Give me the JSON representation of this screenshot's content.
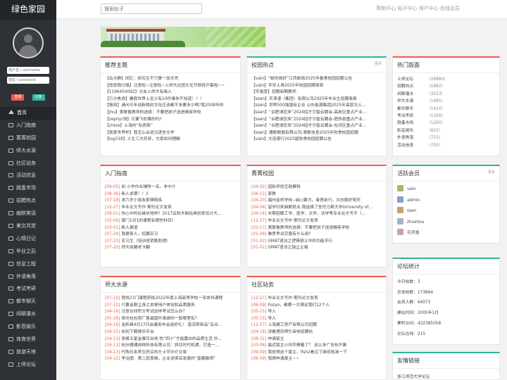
{
  "sidebar": {
    "logo": "绿色家园",
    "username_placeholder": "用户名 / username",
    "password_placeholder": "密码 / password",
    "login_label": "登录",
    "register_label": "注册",
    "nav": [
      {
        "label": "首页",
        "icon": "home-icon"
      },
      {
        "label": "入门指南",
        "icon": "folder-icon"
      },
      {
        "label": "菁菁校园",
        "icon": "folder-icon"
      },
      {
        "label": "师大水源",
        "icon": "folder-icon"
      },
      {
        "label": "社区站务",
        "icon": "folder-icon"
      },
      {
        "label": "活动信息",
        "icon": "folder-icon"
      },
      {
        "label": "跳蚤市场",
        "icon": "folder-icon"
      },
      {
        "label": "招聘热点",
        "icon": "folder-icon"
      },
      {
        "label": "幽默笑话",
        "icon": "folder-icon"
      },
      {
        "label": "美文共赏",
        "icon": "folder-icon"
      },
      {
        "label": "心情日记",
        "icon": "folder-icon"
      },
      {
        "label": "毕业之后",
        "icon": "folder-icon"
      },
      {
        "label": "信息工程",
        "icon": "folder-icon"
      },
      {
        "label": "外语角落",
        "icon": "folder-icon"
      },
      {
        "label": "考试考研",
        "icon": "folder-icon"
      },
      {
        "label": "都市聊天",
        "icon": "folder-icon"
      },
      {
        "label": "闲聊灌水",
        "icon": "folder-icon"
      },
      {
        "label": "影音娱乐",
        "icon": "folder-icon"
      },
      {
        "label": "体育世界",
        "icon": "folder-icon"
      },
      {
        "label": "旅游天地",
        "icon": "folder-icon"
      },
      {
        "label": "上师论坛",
        "icon": "folder-icon"
      }
    ]
  },
  "topbar": {
    "search_placeholder": "搜索帖子",
    "links": "帮助中心  帖子中心  用户中心  在线会员"
  },
  "recommend": {
    "title": "推荐主题",
    "items": [
      "【云点静】回忆：研究生不只是一张文凭",
      "【悠悠我行路】注意啦~注意啦~上师大社团文化节即将开幕啦~~",
      "【1196454092】交友上师大有缘人",
      "【万分焦虑】暑假世界上至少有10件事你不知道！！！",
      "【骆芮】请问今年迎新晚的文化应该都不多要多少啊?我2008年的",
      "【jhu】美联鲁教师的选择：不要把孩子送进精英学校",
      "【zephyr测】又要飞机票的吗?",
      "【chloe】上海的“私房菜”",
      "【我爱世界杯】我怎么会进汉语言文学",
      "【log318】人生三大死穿，大家如何理解"
    ]
  },
  "campus_hot": {
    "title": "校园热点",
    "more": "更多",
    "items": [
      "【vain】“邮你政好”江西邮政2025年春季校园招聘公告",
      "【vain】平安人寿2025年校园招聘简章",
      "【天路宽】招聘新期教师",
      "【ssen】天津港（集团）有限公司2025年毕业生招聘简章",
      "【ssen】世界500强国有企业 山东能源集团2025年高层次人…",
      "【ssen】“合肥请您来”2024招才引智云聘会-高新区重点产业…",
      "【ssen】“合肥请您来”2024招才引智云聘会-肥西县重点产业…",
      "【ssen】“合肥请您来”2024招才引智云聘会-包河区重点产业…",
      "【ssen】德联数据有限公司-寒数信息2025年秋季校园招聘",
      "【vain】大连银行2025届秋季校园招聘公告"
    ]
  },
  "hot_boards": {
    "title": "热门版面",
    "items": [
      {
        "name": "上师论坛",
        "count": "（26880）"
      },
      {
        "name": "招聘热点",
        "count": "（5882）"
      },
      {
        "name": "闲聊灌水",
        "count": "（3153）"
      },
      {
        "name": "师大水源",
        "count": "（1485）"
      },
      {
        "name": "都市聊天",
        "count": "（1410）"
      },
      {
        "name": "考试考研",
        "count": "（1326）"
      },
      {
        "name": "跳蚤市场",
        "count": "（1200）"
      },
      {
        "name": "影音娱乐",
        "count": "（822）"
      },
      {
        "name": "外语角落",
        "count": "（753）"
      },
      {
        "name": "活动信息",
        "count": "（750）"
      }
    ]
  },
  "guide": {
    "title": "入门指南",
    "items": [
      {
        "date": "[09-05]",
        "text": "如 小学作业辅导一名，非中介"
      },
      {
        "date": "[08-26]",
        "text": "新人求罩！！1"
      },
      {
        "date": "[07-18]",
        "text": "求六岁小朋友那辑陪练"
      },
      {
        "date": "[12-27]",
        "text": "毕业论文写作 期刊论文发表"
      },
      {
        "date": "[06-01]",
        "text": "你心中的玩具长啥样？2017云和木制玩具创意设计大…"
      },
      {
        "date": "[05-09]",
        "text": "掌门1对1的课程有哪些科目?"
      },
      {
        "date": "[03-01]",
        "text": "新人报道"
      },
      {
        "date": "[07-24]",
        "text": "我是新人，招募实习"
      },
      {
        "date": "[07-23]",
        "text": "实习生（培训班销售助理）"
      },
      {
        "date": "[07-20]",
        "text": "师大收藏老卡翻"
      }
    ]
  },
  "campus": {
    "title": "菁菁校园",
    "items": [
      {
        "date": "[04-02]",
        "text": "园影师找互助模特"
      },
      {
        "date": "[06-11]",
        "text": "家教"
      },
      {
        "date": "[04-20]",
        "text": "福州金桥学校--诚心聚力，奋勇前行，共创美好明天"
      },
      {
        "date": "[04-08]",
        "text": "留学归来麻薪就业,我选择了圣托马斯大学University of…"
      },
      {
        "date": "[04-14]",
        "text": "长期招聘工学、医学、文学、法学等专业论文写手（…"
      },
      {
        "date": "[12-27]",
        "text": "毕业论文写作 期刊论文发表"
      },
      {
        "date": "[02-17]",
        "text": "美联鲁教师的选择：不要把孩子送进精英学校"
      },
      {
        "date": "[01-08]",
        "text": "雅思考试究竟有什么用?"
      },
      {
        "date": "[01-02]",
        "text": "GMAT语法之逻辑语义中的功能平行"
      },
      {
        "date": "[01-02]",
        "text": "GMAT语法之独立主格"
      }
    ]
  },
  "members": {
    "title": "活跃会员",
    "more": "更多",
    "items": [
      "vain",
      "admin",
      "ssen",
      "zhushou",
      "花灵凰"
    ]
  },
  "water": {
    "title": "师大水源",
    "items": [
      {
        "date": "[07-10]",
        "text": "我校23门课程获批2022年度上海高等学校一流本科课程"
      },
      {
        "date": "[07-10]",
        "text": "只要金服立身之本是用户体验和品质服务"
      },
      {
        "date": "[04-16]",
        "text": "注意在线积分考试这样考试怎么办?"
      },
      {
        "date": "[05-29]",
        "text": "体坊包包剪厂售最国外演谁的一般哪里有?"
      },
      {
        "date": "[04-16]",
        "text": "金和具4月17日会骗发布会选好礼！ 普洱茶新品“云合…"
      },
      {
        "date": "[04-15]",
        "text": "如何下载微乐平台"
      },
      {
        "date": "[04-13]",
        "text": "张裤五星金翼日出地 防“四十”才能震出的品质生活 抄…"
      },
      {
        "date": "[04-13]",
        "text": "杭州德通网络科技有限公司：抓住时代机遇，打造一…"
      },
      {
        "date": "[04-13]",
        "text": "代购日本养生药买的方士可中介交易"
      },
      {
        "date": "[04-12]",
        "text": "李治图：第二层意维，企业逆境深发展的“皇藏脑洞”"
      }
    ]
  },
  "community": {
    "title": "社区站务",
    "items": [
      {
        "date": "[12-27]",
        "text": "毕业论文写作 期刊论文发表"
      },
      {
        "date": "[06-09]",
        "text": "Fozyo，都哪一次满足我们12个人"
      },
      {
        "date": "[05-15]",
        "text": "导入"
      },
      {
        "date": "[05-15]",
        "text": "导入"
      },
      {
        "date": "[12-07]",
        "text": "上海建工房产有限公司招聘"
      },
      {
        "date": "[04-18]",
        "text": "读看理员帮忙审核招聘帖"
      },
      {
        "date": "[08-31]",
        "text": "申请版主"
      },
      {
        "date": "[03-06]",
        "text": "最近版主小吗平睡着了？ 这么多广告帖不删"
      },
      {
        "date": "[09-09]",
        "text": "我觉得这个版主，fish2看见了麻烦批准一下"
      },
      {
        "date": "[06-09]",
        "text": "我想申请版主~~"
      }
    ]
  },
  "stats": {
    "title": "论坛统计",
    "items": [
      "今日帖数：3",
      "总发帖数：173864",
      "会员人数：64073",
      "建站时间：2005年1月",
      "累积访问：432385058",
      "论坛在线：215"
    ]
  },
  "friends": {
    "title": "友情链接",
    "items": [
      "浙江师范大学论坛"
    ]
  },
  "colors": {
    "accent_red": "#e8614b",
    "accent_green": "#2fb59a",
    "sidebar": "#2e3237"
  }
}
